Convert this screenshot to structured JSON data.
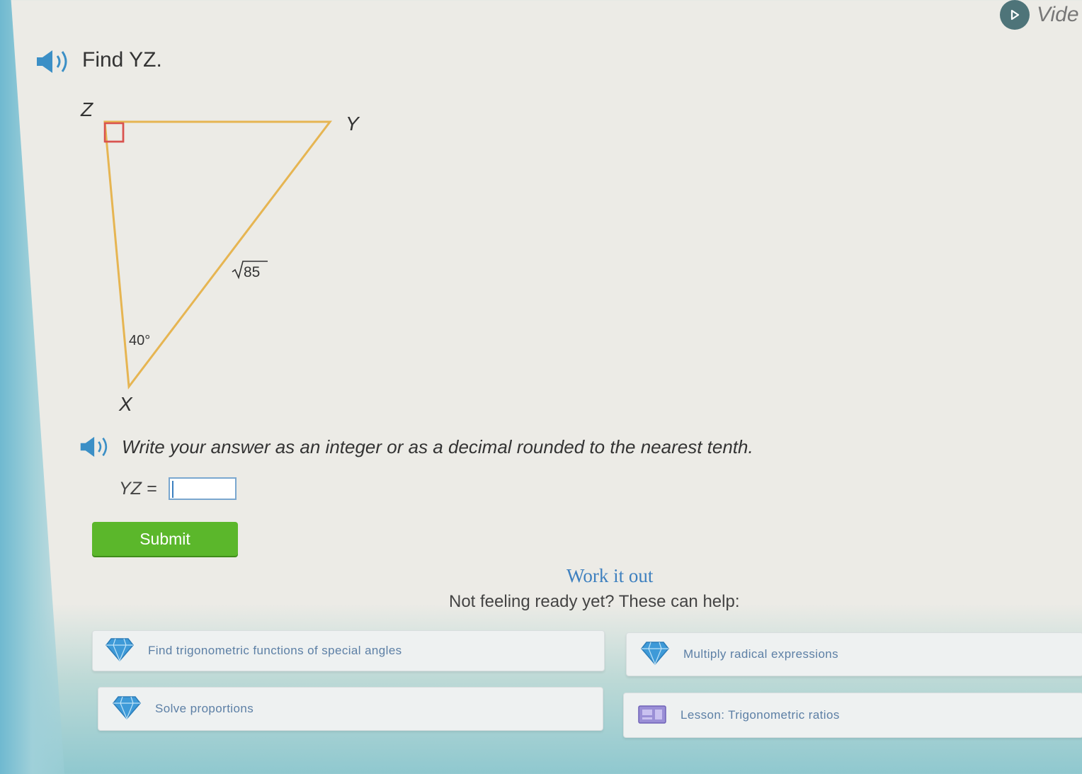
{
  "header": {
    "video_label": "Vide",
    "question": "Find YZ."
  },
  "diagram": {
    "vertex_z": "Z",
    "vertex_y": "Y",
    "vertex_x": "X",
    "hypotenuse_label": "85",
    "angle_label": "40°"
  },
  "instruction": "Write your answer as an integer or as a decimal rounded to the nearest tenth.",
  "answer": {
    "label": "YZ =",
    "value": ""
  },
  "submit_label": "Submit",
  "work_it_out": {
    "title": "Work it out",
    "subtitle": "Not feeling ready yet? These can help:",
    "items": [
      {
        "label": "Find trigonometric functions of special angles",
        "icon": "diamond-icon"
      },
      {
        "label": "Multiply radical expressions",
        "icon": "diamond-icon"
      },
      {
        "label": "Solve proportions",
        "icon": "diamond-icon"
      },
      {
        "label": "Lesson:  Trigonometric ratios",
        "icon": "lesson-icon"
      }
    ]
  },
  "colors": {
    "accent_blue": "#3b8fc6",
    "submit_green": "#5bb72b",
    "triangle_stroke": "#e6b552",
    "right_angle_mark": "#d9534f"
  }
}
